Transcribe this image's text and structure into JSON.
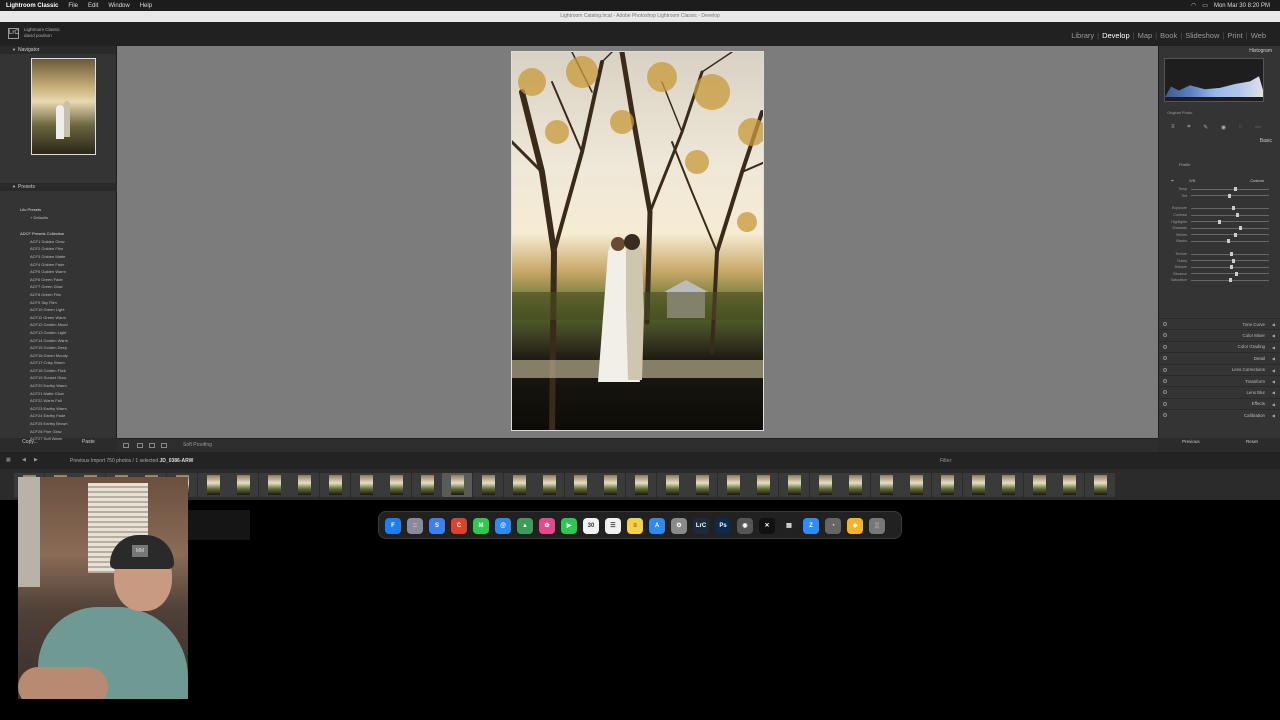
{
  "menubar": {
    "app_name": "Lightroom Classic",
    "items": [
      "File",
      "Edit",
      "Window",
      "Help"
    ],
    "clock": "Mon Mar 30  8:20 PM"
  },
  "window_title": "Lightroom Catalog.lrcat - Adobe Photoshop Lightroom Classic - Develop",
  "identity": {
    "logo": "LrC",
    "line1": "Lightroom Classic",
    "line2": "david poulson"
  },
  "modules": {
    "items": [
      "Library",
      "Develop",
      "Map",
      "Book",
      "Slideshow",
      "Print",
      "Web"
    ],
    "active": "Develop"
  },
  "left_panel": {
    "navigator_label": "Navigator",
    "presets_label": "Presets",
    "preset_groups": [
      {
        "label": "Lito Presets",
        "items": [
          "+ Defaults"
        ]
      },
      {
        "label": "ADCF Presets Collection",
        "items": [
          "ACF1 Golden Glow",
          "ACF2 Golden Film",
          "ACF3 Golden Matte",
          "ACF4 Golden Fade",
          "ACF5 Golden Warm",
          "ACF6 Green Fade",
          "ACF7 Green Glow",
          "ACF8 Green Film",
          "ACF9 Sky Film",
          "ACF10 Green Light",
          "ACF11 Green Warm",
          "ACF12 Golden Mood",
          "ACF13 Golden Light",
          "ACF14 Golden Warm",
          "ACF15 Golden Deep",
          "ACF16 Green Moody",
          "ACF17 Crisp Warm",
          "ACF18 Golden Flick",
          "ACF19 Sunset Glow",
          "ACF20 Earthy Warm",
          "ACF21 Matte Glow",
          "ACF22 Warm Fall",
          "ACF23 Earthy Warm",
          "ACF24 Earthy Fade",
          "ACF25 Earthy Brown",
          "ACF26 Fine Glow",
          "ACF27 Soft Warm"
        ]
      }
    ],
    "copy_label": "Copy...",
    "paste_label": "Paste"
  },
  "toolbar": {
    "soft_proofing_label": "Soft Proofing"
  },
  "right_panel": {
    "histogram_label": "Histogram",
    "original_photo_label": "Original Photo",
    "basic_label": "Basic",
    "profile_label": "Profile",
    "wb_label": "WB",
    "wb_value": "Custom",
    "slider_labels": [
      "Temp",
      "Tint",
      "Exposure",
      "Contrast",
      "Highlights",
      "Shadows",
      "Whites",
      "Blacks",
      "Texture",
      "Clarity",
      "Dehaze",
      "Vibrance",
      "Saturation"
    ],
    "slider_values": [
      0.55,
      0.48,
      0.52,
      0.58,
      0.35,
      0.62,
      0.55,
      0.46,
      0.5,
      0.53,
      0.5,
      0.57,
      0.49
    ],
    "sections": [
      "Tone Curve",
      "Color Mixer",
      "Color Grading",
      "Detail",
      "Lens Corrections",
      "Transform",
      "Lens Blur",
      "Effects",
      "Calibration"
    ],
    "previous_label": "Previous",
    "reset_label": "Reset"
  },
  "filmstrip": {
    "source_label": "Previous Import",
    "count": "750 photos / 1 selected",
    "filename": "JD_0386-ARW",
    "filter_label": "Filter:",
    "thumb_count": 36,
    "selected_index": 14
  },
  "dock": {
    "icons": [
      {
        "name": "finder-icon",
        "glyph": "F",
        "color": "#1e7ef0"
      },
      {
        "name": "launchpad-icon",
        "glyph": "::",
        "color": "#8a8a9a"
      },
      {
        "name": "safari-icon",
        "glyph": "S",
        "color": "#3b7ff0"
      },
      {
        "name": "chrome-icon",
        "glyph": "C",
        "color": "#d9442f"
      },
      {
        "name": "messages-icon",
        "glyph": "M",
        "color": "#2ec84e"
      },
      {
        "name": "mail-icon",
        "glyph": "@",
        "color": "#2f8af0"
      },
      {
        "name": "maps-icon",
        "glyph": "▲",
        "color": "#3a9e5a"
      },
      {
        "name": "photos-icon",
        "glyph": "✿",
        "color": "#e44a8a"
      },
      {
        "name": "facetime-icon",
        "glyph": "▶",
        "color": "#2ec84e"
      },
      {
        "name": "calendar-icon",
        "glyph": "30",
        "color": "#f2f2f2"
      },
      {
        "name": "reminders-icon",
        "glyph": "☰",
        "color": "#f0f0f0"
      },
      {
        "name": "notes-icon",
        "glyph": "≡",
        "color": "#f5d14a"
      },
      {
        "name": "appstore-icon",
        "glyph": "A",
        "color": "#2f8af0"
      },
      {
        "name": "settings-icon",
        "glyph": "⚙",
        "color": "#8a8a8a"
      },
      {
        "name": "lightroom-icon",
        "glyph": "LrC",
        "color": "#1a2b3c"
      },
      {
        "name": "photoshop-icon",
        "glyph": "Ps",
        "color": "#0d2a4a"
      },
      {
        "name": "davinci-icon",
        "glyph": "◉",
        "color": "#555"
      },
      {
        "name": "capcut-icon",
        "glyph": "✕",
        "color": "#111"
      },
      {
        "name": "clapper-icon",
        "glyph": "▤",
        "color": "#222"
      },
      {
        "name": "zoom-icon",
        "glyph": "Z",
        "color": "#2d8cff"
      },
      {
        "name": "istat-icon",
        "glyph": "◔",
        "color": "#666"
      },
      {
        "name": "sketch-icon",
        "glyph": "◆",
        "color": "#f5b32a"
      },
      {
        "name": "trash-icon",
        "glyph": "░",
        "color": "#777"
      }
    ]
  }
}
